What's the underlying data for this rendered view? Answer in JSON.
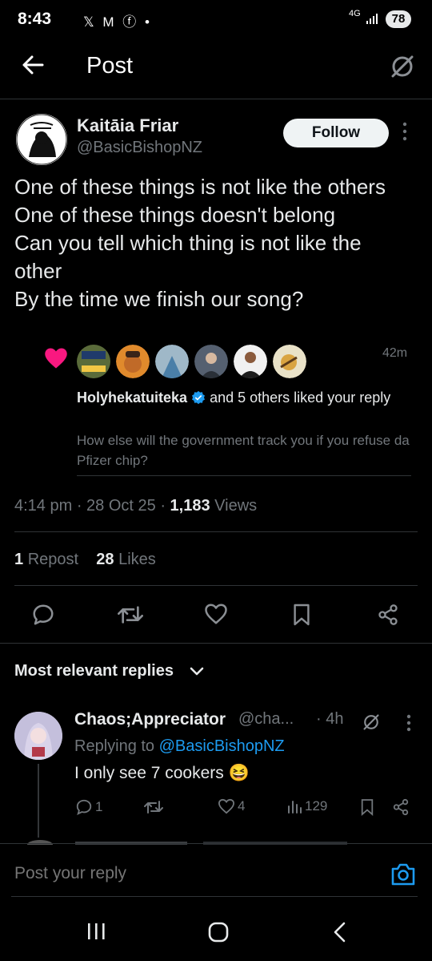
{
  "status_bar": {
    "time": "8:43",
    "icons": "𝕏 M ⓕ •",
    "network": "4G",
    "battery": "78"
  },
  "header": {
    "title": "Post"
  },
  "post": {
    "author_name": "Kaitāia Friar",
    "author_handle": "@BasicBishopNZ",
    "follow_label": "Follow",
    "text_lines": [
      "One of these things is not like the others",
      "One of these things doesn't belong",
      "Can you tell which thing is not like the",
      "other",
      "By the time we finish our song?"
    ],
    "time": "4:14 pm",
    "date": "28 Oct 25",
    "views_count": "1,183",
    "views_label": "Views",
    "reposts_count": "1",
    "reposts_label": "Repost",
    "likes_count": "28",
    "likes_label": "Likes"
  },
  "notification": {
    "time": "42m",
    "user": "Holyhekatuiteka",
    "action_text": "and 5 others liked your reply",
    "quote": "How else will the government track you if you refuse da Pfizer chip?"
  },
  "replies_heading": "Most relevant replies",
  "reply": {
    "name": "Chaos;Appreciator",
    "handle": "@cha...",
    "time": "· 4h",
    "replying_prefix": "Replying to",
    "replying_handle": "@BasicBishopNZ",
    "text": "I only see 7 cookers 😆",
    "comments": "1",
    "likes": "4",
    "views": "129"
  },
  "compose": {
    "placeholder": "Post your reply"
  },
  "colors": {
    "background": "#000000",
    "accent": "#1d9bf0",
    "like": "#f91880",
    "muted": "#71767b"
  }
}
